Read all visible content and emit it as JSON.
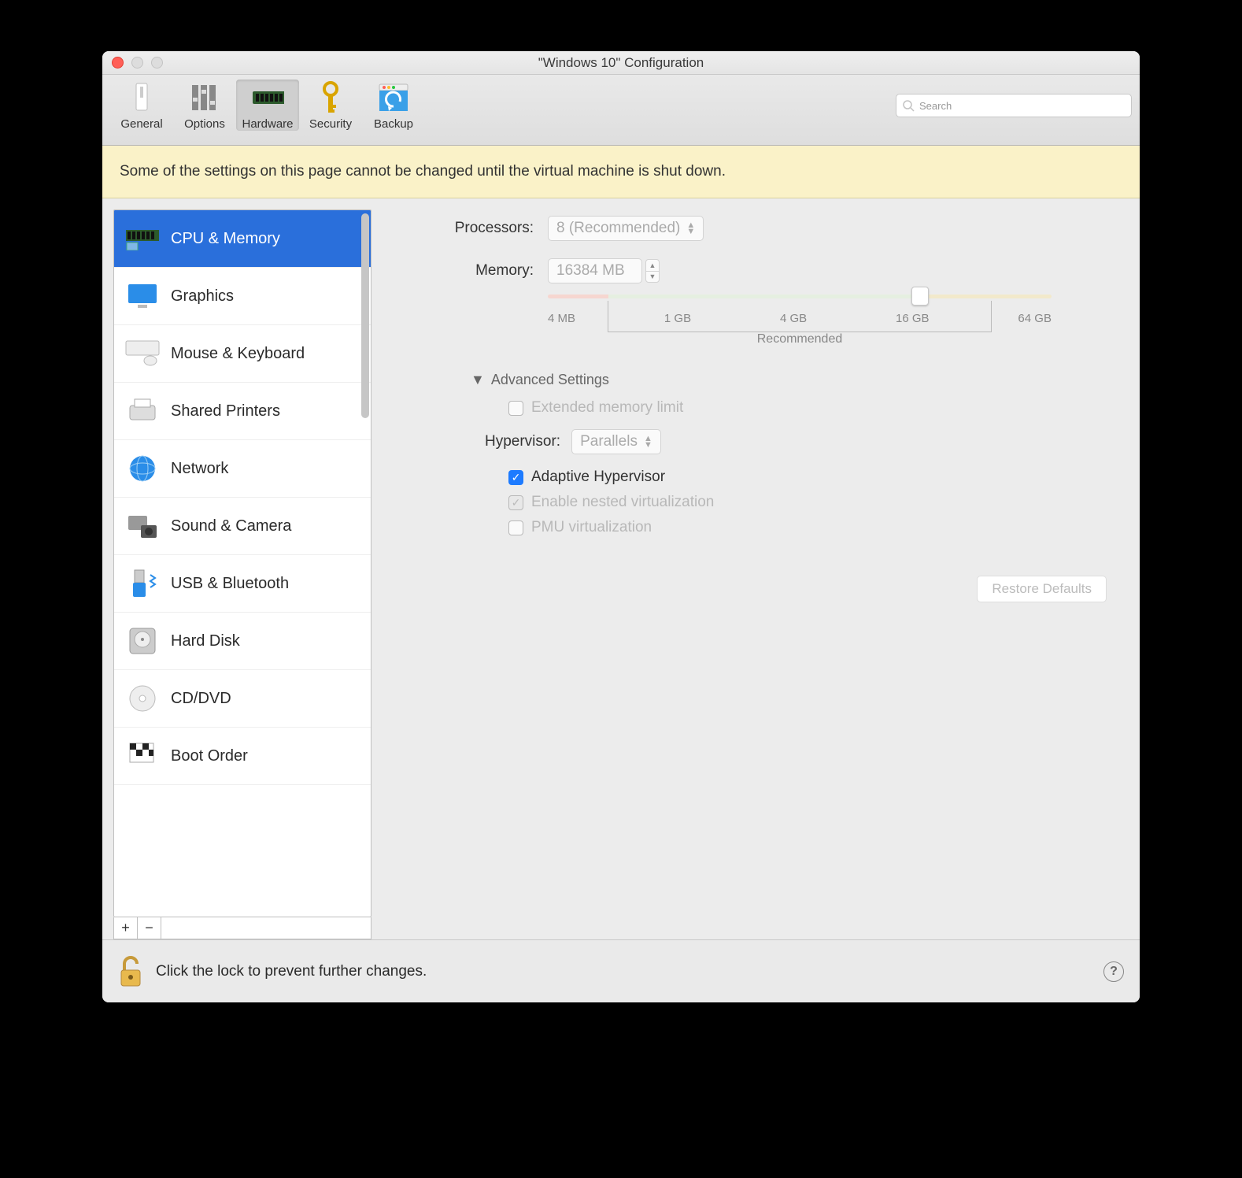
{
  "window": {
    "title": "\"Windows 10\" Configuration"
  },
  "toolbar": {
    "items": [
      {
        "label": "General"
      },
      {
        "label": "Options"
      },
      {
        "label": "Hardware"
      },
      {
        "label": "Security"
      },
      {
        "label": "Backup"
      }
    ],
    "search_placeholder": "Search"
  },
  "warning": "Some of the settings on this page cannot be changed until the virtual machine is shut down.",
  "sidebar": {
    "items": [
      {
        "label": "CPU & Memory"
      },
      {
        "label": "Graphics"
      },
      {
        "label": "Mouse & Keyboard"
      },
      {
        "label": "Shared Printers"
      },
      {
        "label": "Network"
      },
      {
        "label": "Sound & Camera"
      },
      {
        "label": "USB & Bluetooth"
      },
      {
        "label": "Hard Disk"
      },
      {
        "label": "CD/DVD"
      },
      {
        "label": "Boot Order"
      }
    ]
  },
  "main": {
    "processors_label": "Processors:",
    "processors_value": "8 (Recommended)",
    "memory_label": "Memory:",
    "memory_value": "16384 MB",
    "slider_ticks": [
      "4 MB",
      "1 GB",
      "4 GB",
      "16 GB",
      "64 GB"
    ],
    "recommended_label": "Recommended",
    "advanced_label": "Advanced Settings",
    "ext_mem_label": "Extended memory limit",
    "hypervisor_label": "Hypervisor:",
    "hypervisor_value": "Parallels",
    "adaptive_label": "Adaptive Hypervisor",
    "nested_label": "Enable nested virtualization",
    "pmu_label": "PMU virtualization",
    "restore_label": "Restore Defaults"
  },
  "footer": {
    "lock_text": "Click the lock to prevent further changes.",
    "help": "?"
  }
}
